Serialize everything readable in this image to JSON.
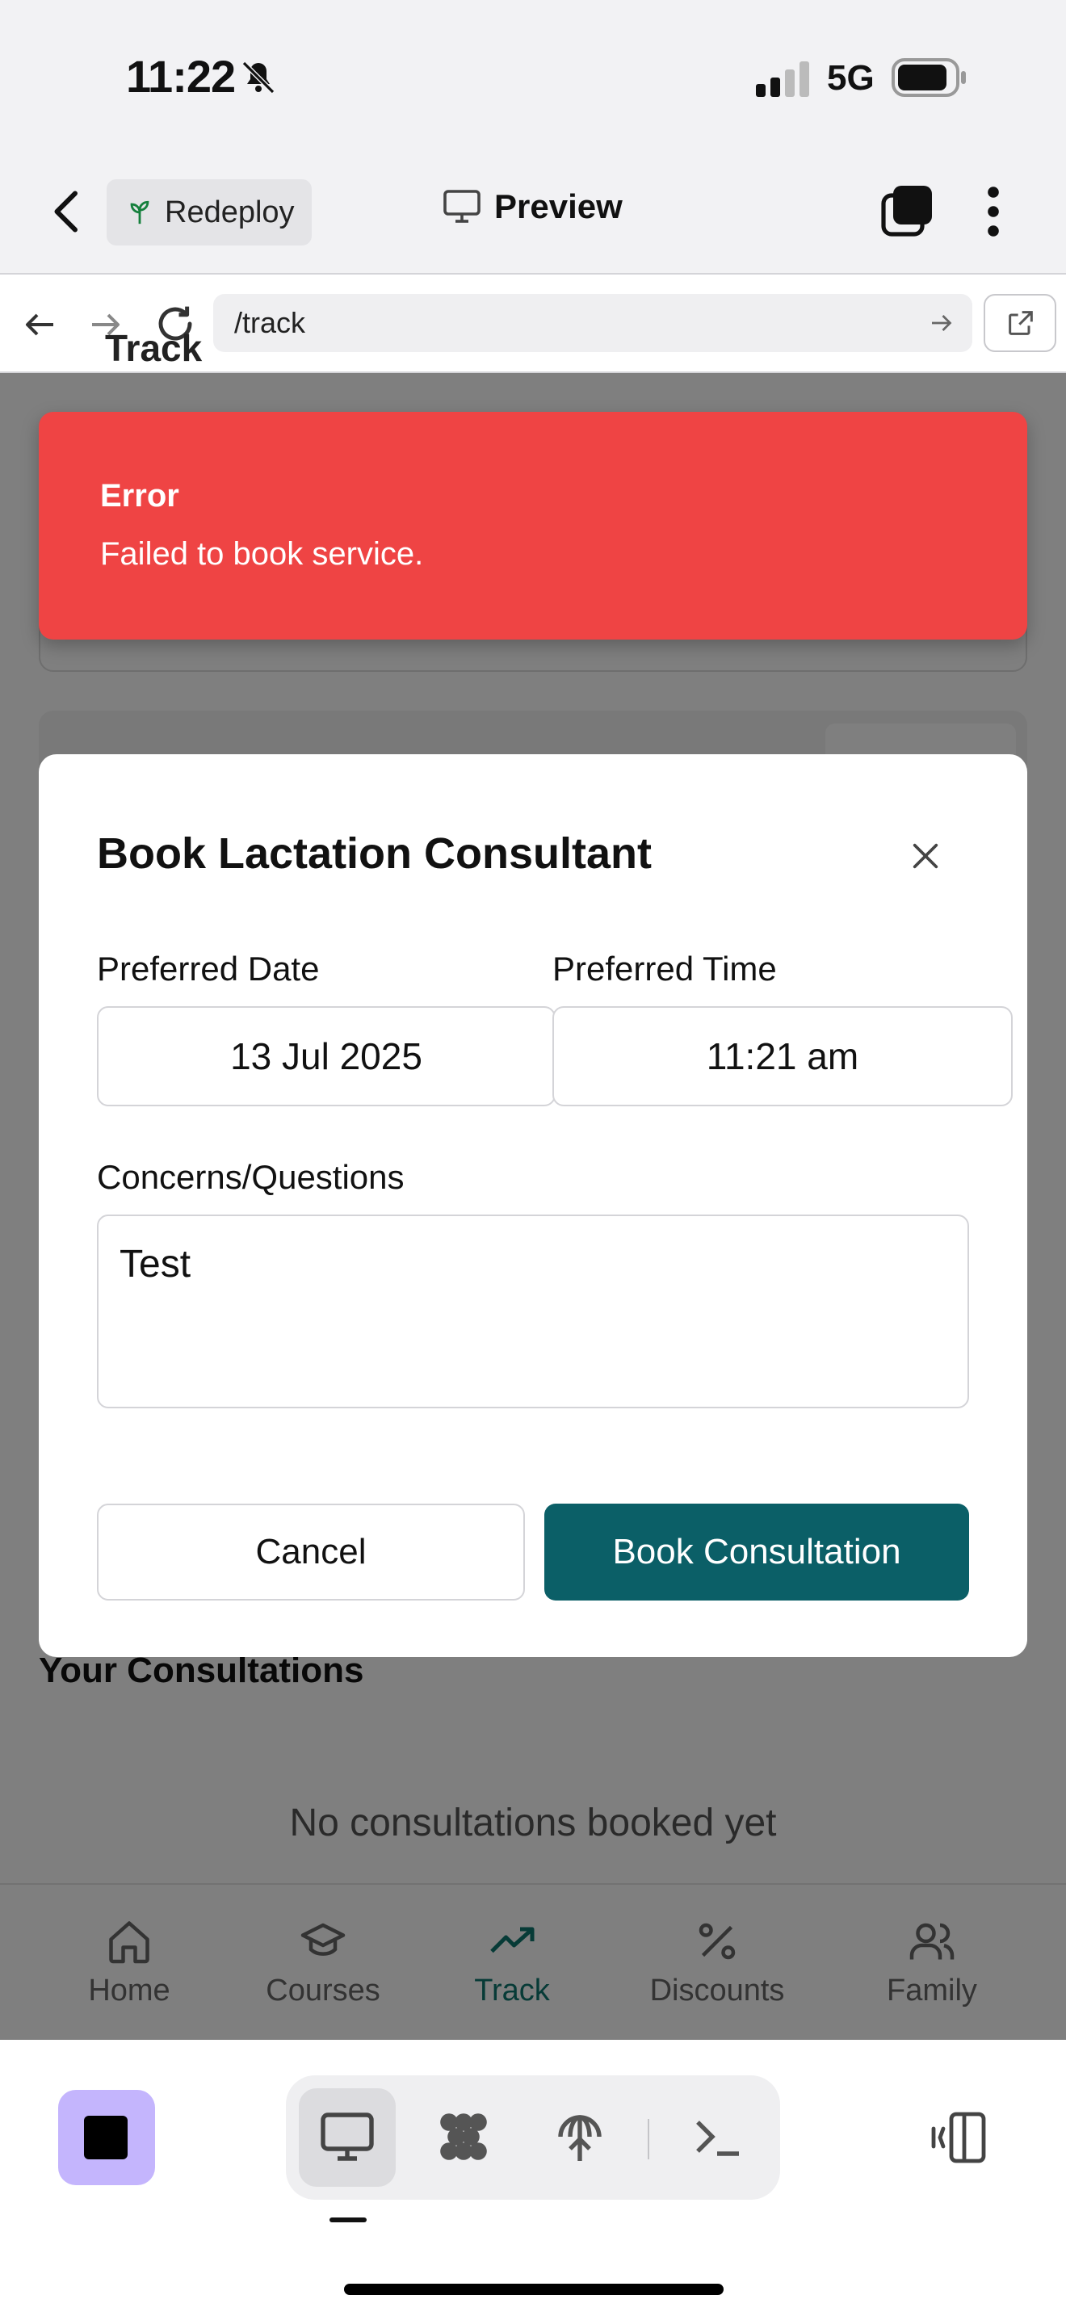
{
  "status_bar": {
    "time": "11:22",
    "network": "5G"
  },
  "header": {
    "redeploy_label": "Redeploy",
    "preview_label": "Preview"
  },
  "browser": {
    "url": "/track"
  },
  "page": {
    "title": "Track",
    "consultations_title": "Your Consultations",
    "empty_message": "No consultations booked yet",
    "tabs": [
      {
        "label": "Home",
        "icon": "home-icon"
      },
      {
        "label": "Courses",
        "icon": "graduation-cap-icon"
      },
      {
        "label": "Track",
        "icon": "trending-up-icon",
        "active": true
      },
      {
        "label": "Discounts",
        "icon": "percent-icon"
      },
      {
        "label": "Family",
        "icon": "users-icon"
      }
    ]
  },
  "toast": {
    "title": "Error",
    "message": "Failed to book service."
  },
  "modal": {
    "title": "Book Lactation Consultant",
    "date_label": "Preferred Date",
    "date_value": "13 Jul 2025",
    "time_label": "Preferred Time",
    "time_value": "11:21 am",
    "concerns_label": "Concerns/Questions",
    "concerns_value": "Test",
    "cancel_label": "Cancel",
    "submit_label": "Book Consultation"
  },
  "colors": {
    "toast_bg": "#ef4444",
    "primary_button": "#0b5f67",
    "active_tab": "#0f766e",
    "stop_button_bg": "#c4b5fd"
  }
}
